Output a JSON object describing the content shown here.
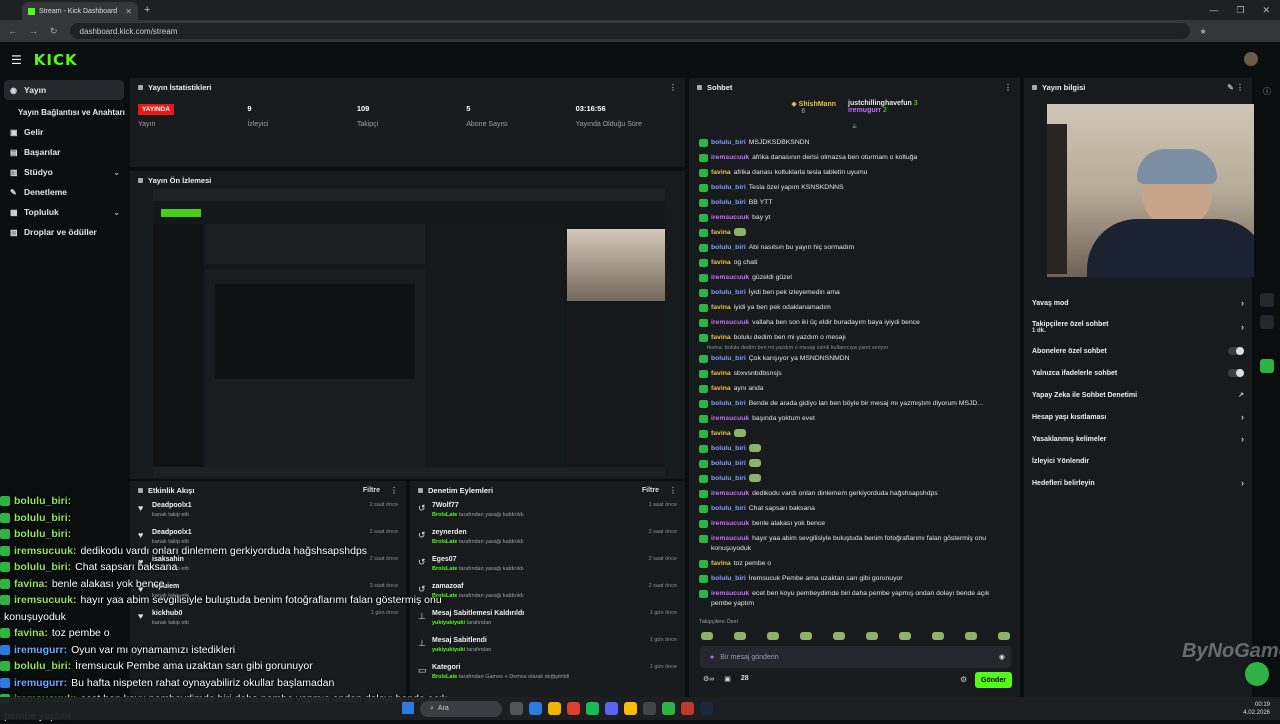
{
  "browser": {
    "tab_title": "Stream - Kick Dashboard",
    "url": "dashboard.kick.com/stream"
  },
  "header": {
    "logo": "KICK"
  },
  "sidebar": {
    "items": [
      {
        "label": "Yayın",
        "icon": "broadcast-icon"
      },
      {
        "label": "Yayın Bağlantısı ve Anahtarı",
        "icon": ""
      },
      {
        "label": "Gelir",
        "icon": "wallet-icon"
      },
      {
        "label": "Başarılar",
        "icon": "trophy-icon"
      },
      {
        "label": "Stüdyo",
        "icon": "studio-icon"
      },
      {
        "label": "Denetleme",
        "icon": "wrench-icon"
      },
      {
        "label": "Topluluk",
        "icon": "people-icon"
      },
      {
        "label": "Droplar ve ödüller",
        "icon": "gift-icon"
      }
    ]
  },
  "stats": {
    "title": "Yayın İstatistikleri",
    "live_badge": "YAYINDA",
    "items": [
      {
        "value": "",
        "label": "Yayın"
      },
      {
        "value": "9",
        "label": "İzleyici"
      },
      {
        "value": "109",
        "label": "Takipçi"
      },
      {
        "value": "5",
        "label": "Abone Sayısı"
      },
      {
        "value": "03:16:56",
        "label": "Yayında Olduğu Süre"
      }
    ]
  },
  "preview": {
    "title": "Yayın Ön İzlemesi"
  },
  "activity": {
    "title": "Etkinlik Akışı",
    "filter": "Filtre",
    "items": [
      {
        "name": "Deadpoolx1",
        "sub": "kanalı takip etti",
        "time": "2 saat önce"
      },
      {
        "name": "Deadpoolx1",
        "sub": "kanalı takip etti",
        "time": "2 saat önce"
      },
      {
        "name": "isaksahin",
        "sub": "kanalı takip etti",
        "time": "2 saat önce"
      },
      {
        "name": "repuiem",
        "sub": "kanalı takip etti",
        "time": "3 saat önce"
      },
      {
        "name": "kickhub0",
        "sub": "kanalı takip etti",
        "time": "1 gün önce"
      }
    ]
  },
  "moderation": {
    "title": "Denetim Eylemleri",
    "filter": "Filtre",
    "items": [
      {
        "name": "7Wolf77",
        "actor": "BrolsLate",
        "sub": "tarafından yasağı kaldırıldı",
        "time": "1 saat önce"
      },
      {
        "name": "zeynerden",
        "actor": "BrolsLate",
        "sub": "tarafından yasağı kaldırıldı",
        "time": "2 saat önce"
      },
      {
        "name": "Eges07",
        "actor": "BrolsLate",
        "sub": "tarafından yasağı kaldırıldı",
        "time": "2 saat önce"
      },
      {
        "name": "zamazoaf",
        "actor": "BrolsLate",
        "sub": "tarafından yasağı kaldırıldı",
        "time": "2 saat önce"
      },
      {
        "name": "Mesaj Sabitlemesi Kaldırıldı",
        "actor": "yukiyukiyuki",
        "sub": "tarafından",
        "time": "1 gün önce"
      },
      {
        "name": "Mesaj Sabitlendi",
        "actor": "yukiyukiyuki",
        "sub": "tarafından",
        "time": "1 gün önce"
      },
      {
        "name": "Kategori",
        "actor": "BrolsLate",
        "sub": "tarafından Games + Demos olarak değiştirildi",
        "time": "1 gün önce"
      }
    ]
  },
  "chat": {
    "title": "Sohbet",
    "top_gifters": [
      {
        "name": "ShishMann",
        "count": "6"
      },
      {
        "name": "justchillinghavefun",
        "count": "3"
      },
      {
        "name": "iremugurr",
        "count": "2"
      }
    ],
    "messages": [
      {
        "user": "bolulu_biri",
        "cls": "u-bolulu",
        "text": "MSJDKSDBKSNDN"
      },
      {
        "user": "iremsucuuk",
        "cls": "u-irem",
        "text": "afrika danasının derisi olmazsa ben oturmam o koltuğa"
      },
      {
        "user": "favina",
        "cls": "u-favina",
        "text": "afrika danası koltuklarla tesla tabletin uyumu"
      },
      {
        "user": "bolulu_biri",
        "cls": "u-bolulu",
        "text": "Tesla özel yapım KSNSKDNNS"
      },
      {
        "user": "bolulu_biri",
        "cls": "u-bolulu",
        "text": "BB YTT"
      },
      {
        "user": "iremsucuuk",
        "cls": "u-irem",
        "text": "bay yt"
      },
      {
        "user": "favina",
        "cls": "u-favina",
        "text": ""
      },
      {
        "user": "bolulu_biri",
        "cls": "u-bolulu",
        "text": "Abi nasılsın bu yayın hiç sormadım"
      },
      {
        "user": "favina",
        "cls": "u-favina",
        "text": "og chati"
      },
      {
        "user": "iremsucuuk",
        "cls": "u-irem",
        "text": "güzeldi güzel"
      },
      {
        "user": "bolulu_biri",
        "cls": "u-bolulu",
        "text": "İyidi ben pek izleyemedin ama"
      },
      {
        "user": "favina",
        "cls": "u-favina",
        "text": "iyidi ya ben pek odaklanamadım"
      },
      {
        "user": "iremsucuuk",
        "cls": "u-irem",
        "text": "vallaha ben son iki üç eldir buradayım baya iyiydi bence"
      },
      {
        "user": "favina",
        "cls": "u-favina",
        "text": "bolulu dedim ben mi yazdım o mesajı"
      },
      {
        "user": "bolulu_biri",
        "cls": "u-bolulu",
        "text": "Çok karışıyor ya MSNDNSNMDN"
      },
      {
        "user": "favina",
        "cls": "u-favina",
        "text": "sbxvsnbdbsnsjs"
      },
      {
        "user": "favina",
        "cls": "u-favina",
        "text": "aynı anda"
      },
      {
        "user": "bolulu_biri",
        "cls": "u-bolulu",
        "text": "Bende de arada gidiyo lan ben böyle bir mesaj mı yazmıştım diyorum MSJD..."
      },
      {
        "user": "iremsucuuk",
        "cls": "u-irem",
        "text": "başında yoktum evet"
      },
      {
        "user": "favina",
        "cls": "u-favina",
        "text": ""
      },
      {
        "user": "bolulu_biri",
        "cls": "u-bolulu",
        "text": ""
      },
      {
        "user": "bolulu_biri",
        "cls": "u-bolulu",
        "text": ""
      },
      {
        "user": "bolulu_biri",
        "cls": "u-bolulu",
        "text": ""
      },
      {
        "user": "iremsucuuk",
        "cls": "u-irem",
        "text": "dedikodu vardı onları dinlemem gerkiyorduda hağshsapshdps"
      },
      {
        "user": "bolulu_biri",
        "cls": "u-bolulu",
        "text": "Chat sapsarı baksana"
      },
      {
        "user": "iremsucuuk",
        "cls": "u-irem",
        "text": "benle alakası yok bence"
      },
      {
        "user": "iremsucuuk",
        "cls": "u-irem",
        "text": "hayır yaa abim sevgilisiyle buluştuda benim fotoğraflarımı falan göstermiş onu konuşuyoduk"
      },
      {
        "user": "favina",
        "cls": "u-favina",
        "text": "toz pembe o"
      },
      {
        "user": "bolulu_biri",
        "cls": "u-bolulu",
        "text": "İremsucuk Pembe ama uzaktan sarı gibi gorunuyor"
      },
      {
        "user": "iremsucuuk",
        "cls": "u-irem",
        "text": "ecet ben koyu pembeydimde biri daha pembe yapmış ondan dolayı bende açık pembe yaptım"
      }
    ],
    "reply_hint": "favina: bolulu dedim ben mi yazdım o mesajı isimli kullanıcıya yanıt veriyor",
    "followers_only": "Takipçilere Özel",
    "input_placeholder": "Bir mesaj gönderin",
    "viewer_count": "28",
    "send_label": "Gönder"
  },
  "stream_info": {
    "title": "Yayın bilgisi",
    "settings": [
      {
        "label": "Yavaş mod",
        "control": "chevron"
      },
      {
        "label": "Takipçilere özel sohbet",
        "sub": "1 dk.",
        "control": "chevron"
      },
      {
        "label": "Abonelere özel sohbet",
        "control": "toggle"
      },
      {
        "label": "Yalnızca ifadelerle sohbet",
        "control": "toggle"
      },
      {
        "label": "Yapay Zeka ile Sohbet Denetimi",
        "control": "external"
      },
      {
        "label": "Hesap yaşı kısıtlaması",
        "control": "chevron"
      },
      {
        "label": "Yasaklanmış kelimeler",
        "control": "chevron"
      },
      {
        "label": "İzleyici Yönlendir",
        "control": "none"
      },
      {
        "label": "Hedefleri belirleyin",
        "control": "chevron"
      }
    ]
  },
  "overlay_chat": [
    {
      "user": "bolulu_biri:",
      "text": "",
      "badge": "green"
    },
    {
      "user": "bolulu_biri:",
      "text": "",
      "badge": "green"
    },
    {
      "user": "bolulu_biri:",
      "text": "",
      "badge": "green"
    },
    {
      "user": "iremsucuuk:",
      "text": "dedikodu vardı onları dinlemem gerkiyorduda hağshsapshdps",
      "badge": "green"
    },
    {
      "user": "bolulu_biri:",
      "text": "Chat sapsarı baksana",
      "badge": "green"
    },
    {
      "user": "favina:",
      "text": "benle alakası yok bence",
      "badge": "green"
    },
    {
      "user": "iremsucuuk:",
      "text": "hayır yaa abim sevgilisiyle buluştuda benim fotoğraflarımı falan göstermiş onu",
      "badge": "green"
    },
    {
      "user": "",
      "text": "konuşuyoduk",
      "badge": "none"
    },
    {
      "user": "favina:",
      "text": "toz pembe o",
      "badge": "green"
    },
    {
      "user": "iremugurr:",
      "text": "Oyun var mı oynamamızı istedikleri",
      "badge": "blue"
    },
    {
      "user": "bolulu_biri:",
      "text": "İremsucuk Pembe ama uzaktan sarı gibi gorunuyor",
      "badge": "green"
    },
    {
      "user": "iremugurr:",
      "text": "Bu hafta nispeten rahat oynayabiliriz okullar başlamadan",
      "badge": "blue"
    },
    {
      "user": "iremsucuuk:",
      "text": "ecet ben koyu pembeydimde biri daha pembe yapmış ondan dolayı bende açık",
      "badge": "green"
    },
    {
      "user": "",
      "text": "pembe yaptım",
      "badge": "none"
    }
  ],
  "watermark": "ByNoGame",
  "taskbar": {
    "search": "Ara",
    "time": "00:19",
    "date": "4.02.2026"
  },
  "colors": {
    "brand": "#53fc18",
    "live": "#e91916",
    "panel": "#181b1e",
    "background": "#0b0e0f"
  }
}
